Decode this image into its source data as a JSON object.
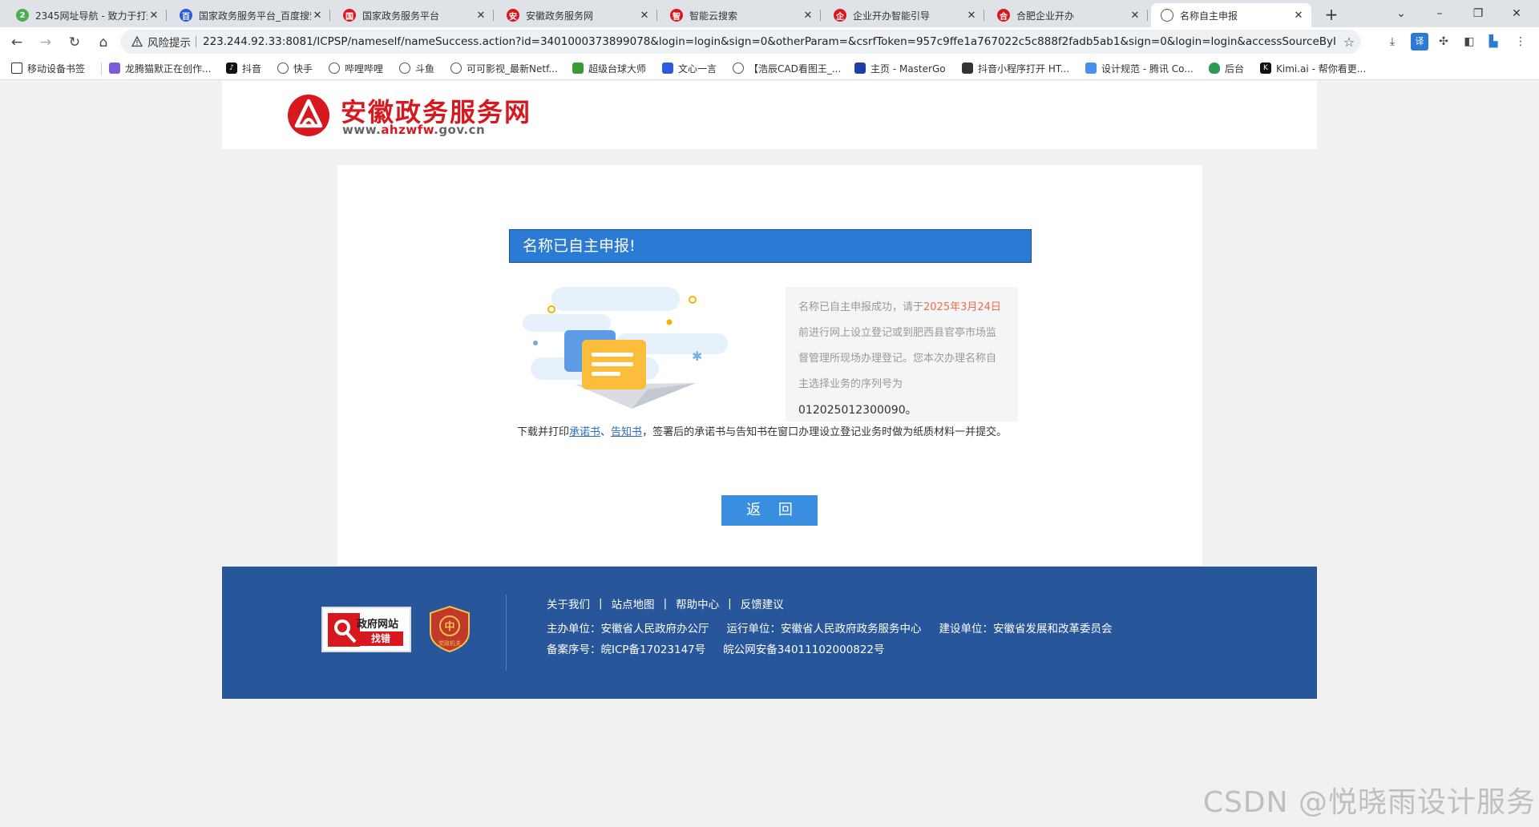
{
  "browser": {
    "tabs": [
      {
        "title": "2345网址导航 - 致力于打造...",
        "fav_color": "#4caf50",
        "fav_text": "2"
      },
      {
        "title": "国家政务服务平台_百度搜索",
        "fav_color": "#2b5bd7",
        "fav_text": "百"
      },
      {
        "title": "国家政务服务平台",
        "fav_color": "#d7191f",
        "fav_text": "国"
      },
      {
        "title": "安徽政务服务网",
        "fav_color": "#d7191f",
        "fav_text": "安"
      },
      {
        "title": "智能云搜索",
        "fav_color": "#d7191f",
        "fav_text": "智"
      },
      {
        "title": "企业开办智能引导",
        "fav_color": "#d7191f",
        "fav_text": "企"
      },
      {
        "title": "合肥企业开办",
        "fav_color": "#d7191f",
        "fav_text": "合"
      },
      {
        "title": "名称自主申报",
        "fav_color": "#666666",
        "fav_text": "",
        "active": true
      }
    ],
    "new_tab": "+",
    "window_controls": {
      "dropdown": "⌄",
      "minimize": "–",
      "restore": "❐",
      "close": "✕"
    },
    "address": {
      "risk_label": "风险提示",
      "url": "223.244.92.33:8081/ICPSP/nameself/nameSuccess.action?id=3401000373899078&login=login&sign=0&otherParam=&csrfToken=957c9ffe1a767022c5c888f2fadb5ab1&sign=0&login=login&accessSourceByIn..."
    },
    "bookmarks": [
      "移动设备书签",
      "龙腾猫默正在创作...",
      "抖音",
      "快手",
      "哔哩哔哩",
      "斗鱼",
      "可可影视_最新Netf...",
      "超级台球大师",
      "文心一言",
      "【浩辰CAD看图王_...",
      "主页 - MasterGo",
      "抖音小程序打开 HT...",
      "设计规范 - 腾讯 Co...",
      "后台",
      "Kimi.ai - 帮你看更..."
    ]
  },
  "site": {
    "name": "安徽政务服务网",
    "url_prefix": "www.",
    "url_highlight": "ahzwfw",
    "url_suffix": ".gov.cn"
  },
  "result": {
    "banner": "名称已自主申报!",
    "msg_pre": "名称已自主申报成功，请于",
    "msg_date": "2025年3月24日",
    "msg_post": "前进行网上设立登记或到肥西县官亭市场监督管理所现场办理登记。您本次办理名称自主选择业务的序列号为",
    "seq_no": "012025012300090。",
    "note_pre": "下载并打印",
    "link_commit": "承诺书",
    "note_sep": "、",
    "link_notice": "告知书",
    "note_post": "，签署后的承诺书与告知书在窗口办理设立登记业务时做为纸质材料一并提交。",
    "back_button": "返 回"
  },
  "footer": {
    "badge1_title": "政府网站",
    "badge1_sub": "找错",
    "badge2_label": "党政机关",
    "links": [
      "关于我们",
      "站点地图",
      "帮助中心",
      "反馈建议"
    ],
    "pipe": "|",
    "host": "主办单位：安徽省人民政府办公厅",
    "operator": "运行单位：安徽省人民政府政务服务中心",
    "builder": "建设单位：安徽省发展和改革委员会",
    "icp": "备案序号：皖ICP备17023147号",
    "police": "皖公网安备34011102000822号"
  },
  "watermark": "CSDN @悦晓雨设计服务"
}
